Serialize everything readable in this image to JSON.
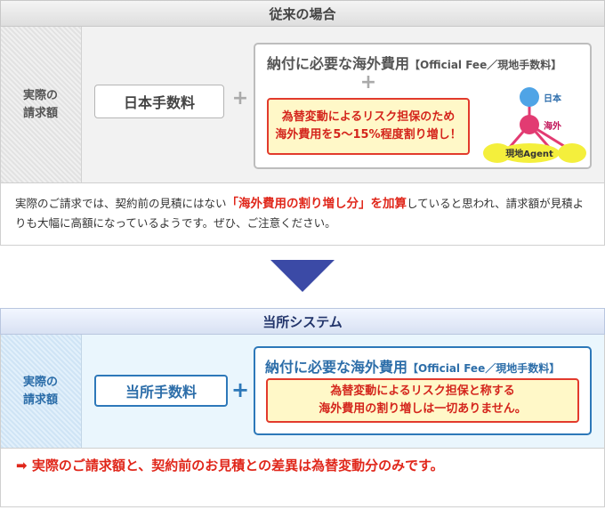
{
  "old_section": {
    "title": "従来の場合",
    "row_label": "実際の\n請求額",
    "fee_box": "日本手数料",
    "plus": "+",
    "overseas_title_main": "納付に必要な海外費用",
    "overseas_title_sub": "【Official Fee／現地手数料】",
    "warning_line1": "為替変動によるリスク担保のため",
    "warning_line2": "海外費用を5〜15%程度割り増し！",
    "diagram_labels": {
      "japan": "日本",
      "overseas": "海外",
      "local_agent": "現地Agent"
    },
    "description_part1": "実際のご請求では、契約前の見積にはない",
    "description_highlight": "「海外費用の割り増し分」を加算",
    "description_part2": "していると思われ、請求額が見積よりも大幅に高額になっているようです。ぜひ、ご注意ください。"
  },
  "new_section": {
    "title": "当所システム",
    "row_label": "実際の\n請求額",
    "fee_box": "当所手数料",
    "plus": "+",
    "overseas_title_main": "納付に必要な海外費用",
    "overseas_title_sub": "【Official Fee／現地手数料】",
    "note_line1": "為替変動によるリスク担保と称する",
    "note_line2": "海外費用の割り増しは一切ありません。",
    "conclusion_arrow": "➡",
    "conclusion": "実際のご請求額と、契約前のお見積との差異は為替変動分のみです。"
  },
  "colors": {
    "accent_red": "#e0271b",
    "accent_blue": "#2d78b9",
    "arrow_navy": "#3b4aa6",
    "warning_bg": "#fff8c8"
  }
}
